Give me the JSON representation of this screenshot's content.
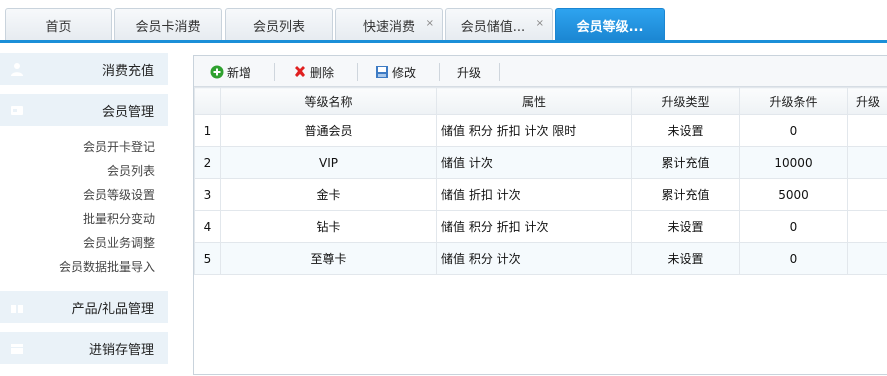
{
  "tabs": [
    {
      "label": "首页",
      "closable": false,
      "active": false
    },
    {
      "label": "会员卡消费",
      "closable": false,
      "active": false
    },
    {
      "label": "会员列表",
      "closable": false,
      "active": false
    },
    {
      "label": "快速消费",
      "closable": true,
      "active": false
    },
    {
      "label": "会员储值...",
      "closable": true,
      "active": false
    },
    {
      "label": "会员等级...",
      "closable": false,
      "active": true
    }
  ],
  "tab_close_glyph": "×",
  "sidebar": {
    "sections": [
      {
        "label": "消费充值",
        "icon": "user-icon"
      },
      {
        "label": "会员管理",
        "icon": "card-icon"
      },
      {
        "label": "产品/礼品管理",
        "icon": "gift-icon"
      },
      {
        "label": "进销存管理",
        "icon": "box-icon"
      }
    ],
    "member_items": [
      "会员开卡登记",
      "会员列表",
      "会员等级设置",
      "批量积分变动",
      "会员业务调整",
      "会员数据批量导入"
    ]
  },
  "toolbar": {
    "add_label": "新增",
    "delete_label": "删除",
    "edit_label": "修改",
    "upgrade_label": "升级"
  },
  "grid": {
    "columns": [
      "",
      "等级名称",
      "属性",
      "升级类型",
      "升级条件",
      "升级"
    ],
    "rows": [
      {
        "idx": "1",
        "name": "普通会员",
        "attr": "储值 积分 折扣 计次 限时",
        "type": "未设置",
        "cond": "0",
        "next": "未"
      },
      {
        "idx": "2",
        "name": "VIP",
        "attr": "储值 计次",
        "type": "累计充值",
        "cond": "10000",
        "next": "普"
      },
      {
        "idx": "3",
        "name": "金卡",
        "attr": "储值 折扣 计次",
        "type": "累计充值",
        "cond": "5000",
        "next": ""
      },
      {
        "idx": "4",
        "name": "钻卡",
        "attr": "储值 积分 折扣 计次",
        "type": "未设置",
        "cond": "0",
        "next": "未"
      },
      {
        "idx": "5",
        "name": "至尊卡",
        "attr": "储值 积分 计次",
        "type": "未设置",
        "cond": "0",
        "next": "未"
      }
    ]
  },
  "colors": {
    "accent": "#1b8fd8",
    "danger": "#e02020"
  }
}
